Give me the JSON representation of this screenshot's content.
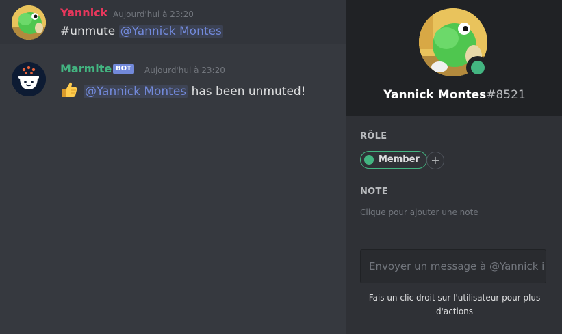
{
  "messages": [
    {
      "author": "Yannick",
      "author_color": "#ed4245",
      "timestamp": "Aujourd'hui à 23:20",
      "text_prefix": "#unmute",
      "mention": "@Yannick Montes"
    },
    {
      "author": "Marmite",
      "author_color": "#43b581",
      "bot_tag": "BOT",
      "timestamp": "Aujourd'hui à 23:20",
      "emoji": "thumbs-up",
      "mention": "@Yannick Montes",
      "text_suffix": "has been unmuted!"
    }
  ],
  "profile": {
    "username": "Yannick Montes",
    "discriminator": "#8521",
    "status_color": "#43b581",
    "role_section_title": "RÔLE",
    "role": "Member",
    "role_color": "#43b581",
    "add_role": "+",
    "note_section_title": "NOTE",
    "note_placeholder": "Clique pour ajouter une note",
    "message_placeholder": "Envoyer un message à @Yannick i",
    "hint": "Fais un clic droit sur l'utilisateur pour plus d'actions"
  }
}
